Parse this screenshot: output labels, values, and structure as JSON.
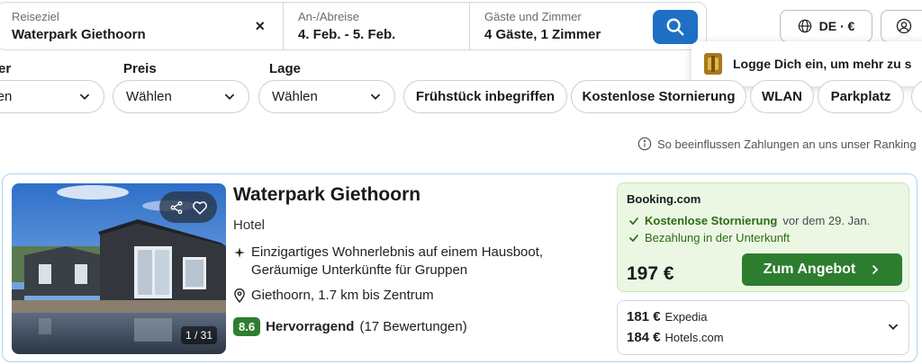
{
  "search": {
    "destination_label": "Reiseziel",
    "destination_value": "Waterpark Giethoorn",
    "clear_symbol": "×",
    "dates_label": "An-/Abreise",
    "dates_value": "4. Feb. - 5. Feb.",
    "guests_label": "Gäste und Zimmer",
    "guests_value": "4 Gäste, 1 Zimmer",
    "search_icon": "search-icon"
  },
  "header": {
    "locale": "DE · €",
    "login_prompt": "Logge Dich ein, um mehr zu s"
  },
  "filters": {
    "cut_label": "er",
    "cut_dropdown": "hlen",
    "price_label": "Preis",
    "price_value": "Wählen",
    "location_label": "Lage",
    "location_value": "Wählen",
    "chips": [
      "Frühstück inbegriffen",
      "Kostenlose Stornierung",
      "WLAN",
      "Parkplatz"
    ]
  },
  "ranking_note": "So beeinflussen Zahlungen an uns unser Ranking",
  "hotel": {
    "name": "Waterpark Giethoorn",
    "type": "Hotel",
    "description_line1": "Einzigartiges Wohnerlebnis auf einem Hausboot,",
    "description_line2": "Geräumige Unterkünfte für Gruppen",
    "location": "Giethoorn, 1.7 km bis Zentrum",
    "rating_score": "8.6",
    "rating_word": "Hervorragend",
    "review_count": "(17 Bewertungen)",
    "photo_counter": "1 / 31"
  },
  "offer": {
    "provider": "Booking.com",
    "perk1_strong": "Kostenlose Stornierung",
    "perk1_rest": "vor dem 29. Jan.",
    "perk2": "Bezahlung in der Unterkunft",
    "price": "197 €",
    "button_label": "Zum Angebot",
    "alternatives": [
      {
        "price": "181 €",
        "provider": "Expedia"
      },
      {
        "price": "184 €",
        "provider": "Hotels.com"
      }
    ]
  },
  "colors": {
    "primary_blue": "#1f6fc4",
    "deal_green": "#2d7d2f",
    "rating_green": "#2f7d32",
    "offer_bg": "#ebf7e3",
    "card_border": "#a9d3ec"
  }
}
